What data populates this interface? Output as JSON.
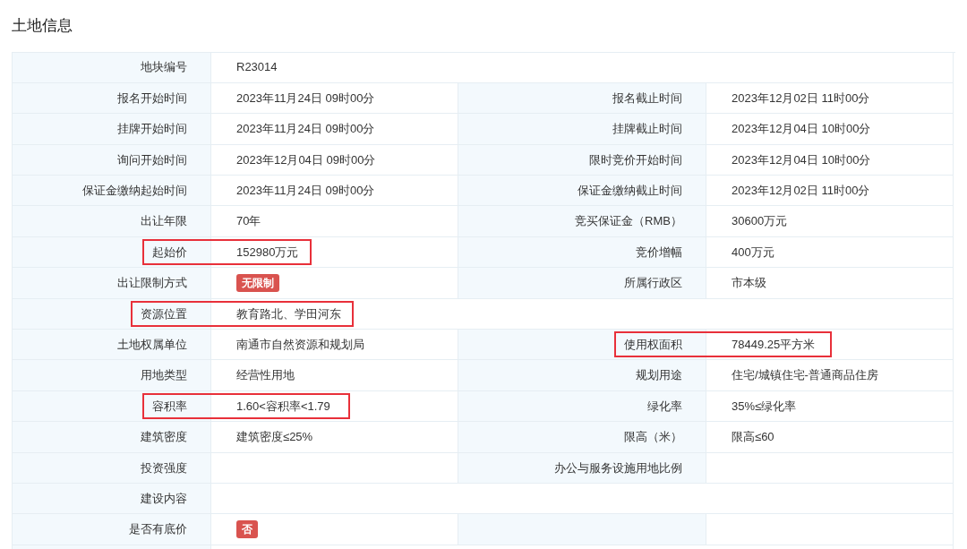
{
  "title": "土地信息",
  "rows": [
    {
      "wide": true,
      "cells": [
        {
          "label": "地块编号",
          "value": "R23014",
          "kind": "text",
          "highlighted": false
        }
      ]
    },
    {
      "wide": false,
      "cells": [
        {
          "label": "报名开始时间",
          "value": "2023年11月24日 09时00分",
          "kind": "text",
          "highlighted": false
        },
        {
          "label": "报名截止时间",
          "value": "2023年12月02日 11时00分",
          "kind": "text",
          "highlighted": false
        }
      ]
    },
    {
      "wide": false,
      "cells": [
        {
          "label": "挂牌开始时间",
          "value": "2023年11月24日 09时00分",
          "kind": "text",
          "highlighted": false
        },
        {
          "label": "挂牌截止时间",
          "value": "2023年12月04日 10时00分",
          "kind": "text",
          "highlighted": false
        }
      ]
    },
    {
      "wide": false,
      "cells": [
        {
          "label": "询问开始时间",
          "value": "2023年12月04日 09时00分",
          "kind": "text",
          "highlighted": false
        },
        {
          "label": "限时竞价开始时间",
          "value": "2023年12月04日 10时00分",
          "kind": "text",
          "highlighted": false
        }
      ]
    },
    {
      "wide": false,
      "cells": [
        {
          "label": "保证金缴纳起始时间",
          "value": "2023年11月24日 09时00分",
          "kind": "text",
          "highlighted": false
        },
        {
          "label": "保证金缴纳截止时间",
          "value": "2023年12月02日 11时00分",
          "kind": "text",
          "highlighted": false
        }
      ]
    },
    {
      "wide": false,
      "cells": [
        {
          "label": "出让年限",
          "value": "70年",
          "kind": "text",
          "highlighted": false
        },
        {
          "label": "竞买保证金（RMB）",
          "value": "30600万元",
          "kind": "text",
          "highlighted": false
        }
      ]
    },
    {
      "wide": false,
      "cells": [
        {
          "label": "起始价",
          "value": "152980万元",
          "kind": "text",
          "highlighted": true
        },
        {
          "label": "竞价增幅",
          "value": "400万元",
          "kind": "text",
          "highlighted": false
        }
      ]
    },
    {
      "wide": false,
      "cells": [
        {
          "label": "出让限制方式",
          "value": "无限制",
          "kind": "badge",
          "highlighted": false
        },
        {
          "label": "所属行政区",
          "value": "市本级",
          "kind": "text",
          "highlighted": false
        }
      ]
    },
    {
      "wide": true,
      "cells": [
        {
          "label": "资源位置",
          "value": "教育路北、学田河东",
          "kind": "text",
          "highlighted": true
        }
      ]
    },
    {
      "wide": false,
      "cells": [
        {
          "label": "土地权属单位",
          "value": "南通市自然资源和规划局",
          "kind": "text",
          "highlighted": false
        },
        {
          "label": "使用权面积",
          "value": "78449.25平方米",
          "kind": "text",
          "highlighted": true
        }
      ]
    },
    {
      "wide": false,
      "cells": [
        {
          "label": "用地类型",
          "value": "经营性用地",
          "kind": "text",
          "highlighted": false
        },
        {
          "label": "规划用途",
          "value": "住宅/城镇住宅-普通商品住房",
          "kind": "text",
          "highlighted": false
        }
      ]
    },
    {
      "wide": false,
      "cells": [
        {
          "label": "容积率",
          "value": "1.60<容积率<1.79",
          "kind": "text",
          "highlighted": true
        },
        {
          "label": "绿化率",
          "value": "35%≤绿化率",
          "kind": "text",
          "highlighted": false
        }
      ]
    },
    {
      "wide": false,
      "cells": [
        {
          "label": "建筑密度",
          "value": "建筑密度≤25%",
          "kind": "text",
          "highlighted": false
        },
        {
          "label": "限高（米）",
          "value": "限高≤60",
          "kind": "text",
          "highlighted": false
        }
      ]
    },
    {
      "wide": false,
      "cells": [
        {
          "label": "投资强度",
          "highlighted": false
        },
        {
          "label": "办公与服务设施用地比例",
          "highlighted": false
        }
      ]
    },
    {
      "wide": true,
      "cells": [
        {
          "label": "建设内容",
          "highlighted": false
        }
      ]
    },
    {
      "wide": false,
      "cells": [
        {
          "label": "是否有底价",
          "value": "否",
          "kind": "badge",
          "highlighted": false
        }
      ]
    }
  ]
}
